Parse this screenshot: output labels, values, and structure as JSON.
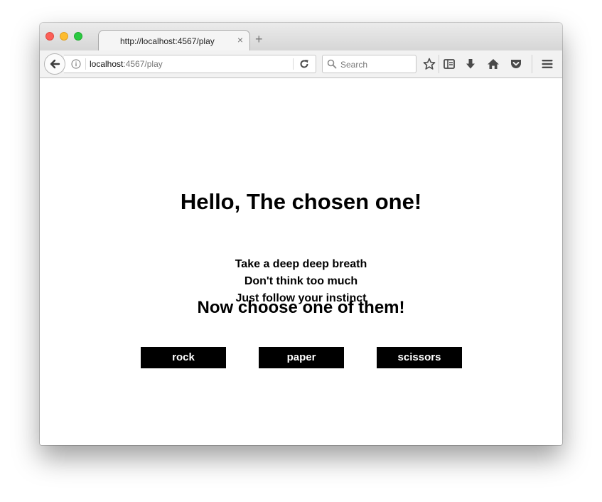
{
  "browser": {
    "tab": {
      "title": "http://localhost:4567/play",
      "close": "×"
    },
    "new_tab": "+",
    "url": {
      "host": "localhost",
      "rest": ":4567/play"
    },
    "search": {
      "placeholder": "Search"
    },
    "toolbar_icons": [
      "star-icon",
      "reading-list-icon",
      "download-icon",
      "home-icon",
      "pocket-icon",
      "menu-icon"
    ]
  },
  "page": {
    "heading": "Hello, The chosen one!",
    "lines": [
      "Take a deep deep breath",
      "Don't think too much",
      "Just follow your instinct"
    ],
    "subheading": "Now choose one of them!",
    "choices": [
      "rock",
      "paper",
      "scissors"
    ]
  },
  "colors": {
    "close_traffic": "#fc5f57",
    "minimize_traffic": "#fdbc2e",
    "zoom_traffic": "#29c940",
    "button_bg": "#000000",
    "button_text": "#ffffff"
  }
}
